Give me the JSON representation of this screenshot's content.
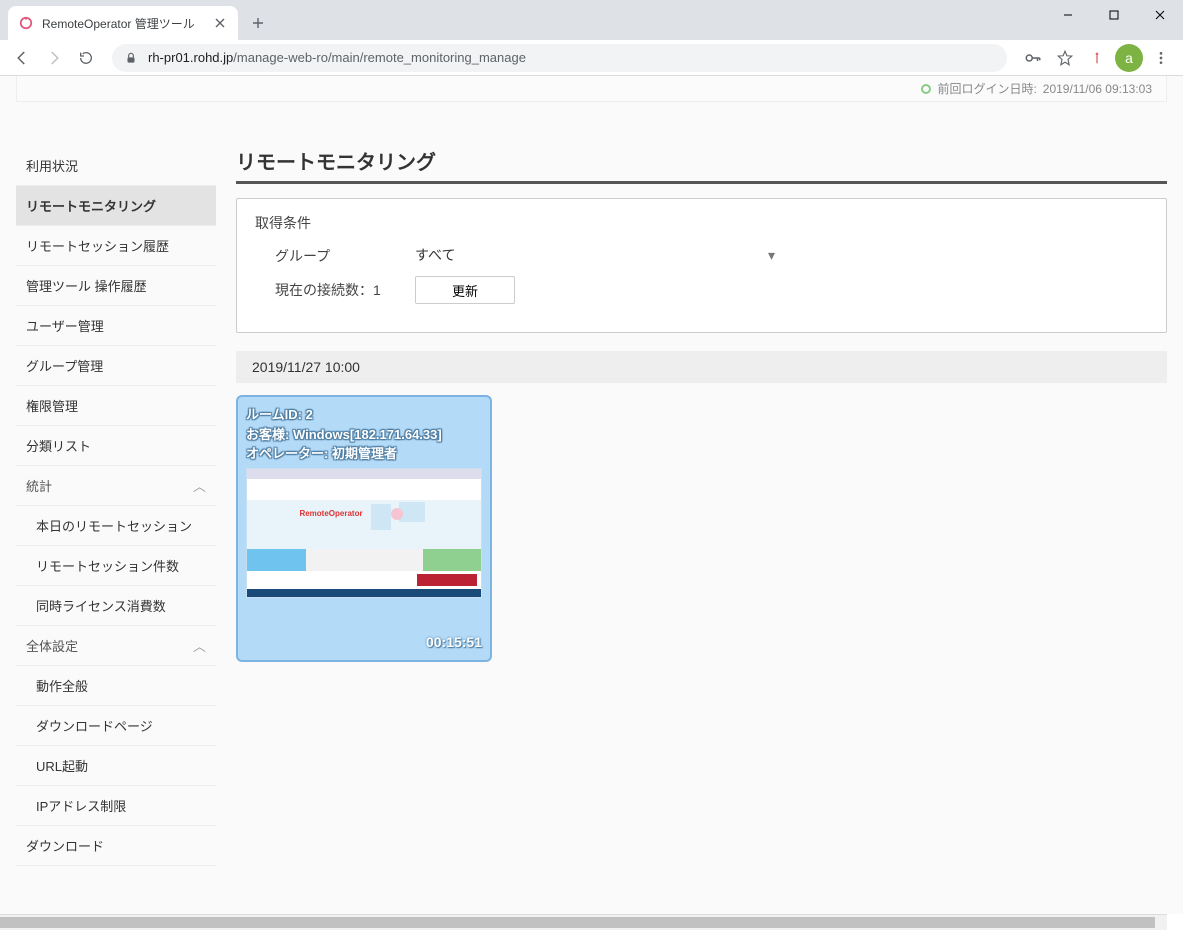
{
  "browser": {
    "tab_title": "RemoteOperator 管理ツール",
    "url_host": "rh-pr01.rohd.jp",
    "url_path": "/manage-web-ro/main/remote_monitoring_manage",
    "avatar_letter": "a"
  },
  "header": {
    "last_login_label": "前回ログイン日時:",
    "last_login_value": "2019/11/06 09:13:03"
  },
  "sidebar": {
    "items": [
      {
        "label": "利用状況"
      },
      {
        "label": "リモートモニタリング",
        "active": true
      },
      {
        "label": "リモートセッション履歴"
      },
      {
        "label": "管理ツール 操作履歴"
      },
      {
        "label": "ユーザー管理"
      },
      {
        "label": "グループ管理"
      },
      {
        "label": "権限管理"
      },
      {
        "label": "分類リスト"
      }
    ],
    "stats_section": {
      "label": "統計",
      "children": [
        {
          "label": "本日のリモートセッション"
        },
        {
          "label": "リモートセッション件数"
        },
        {
          "label": "同時ライセンス消費数"
        }
      ]
    },
    "settings_section": {
      "label": "全体設定",
      "children": [
        {
          "label": "動作全般"
        },
        {
          "label": "ダウンロードページ"
        },
        {
          "label": "URL起動"
        },
        {
          "label": "IPアドレス制限"
        }
      ]
    },
    "download_label": "ダウンロード"
  },
  "main": {
    "title": "リモートモニタリング",
    "filter": {
      "header": "取得条件",
      "group_label": "グループ",
      "group_value": "すべて",
      "connections_label": "現在の接続数：",
      "connections_value": "1",
      "update_button": "更新"
    },
    "timestamp": "2019/11/27 10:00",
    "session": {
      "room_label": "ルームID:",
      "room_id": "2",
      "customer_label": "お客様:",
      "customer_value": "Windows[182.171.64.33]",
      "operator_label": "オペレーター:",
      "operator_value": "初期管理者",
      "elapsed": "00:15:51",
      "thumb_brand": "RemoteOperator"
    }
  },
  "colors": {
    "accent_blue": "#b3daf6",
    "accent_border": "#7db3e0",
    "avatar_green": "#7cb342"
  }
}
